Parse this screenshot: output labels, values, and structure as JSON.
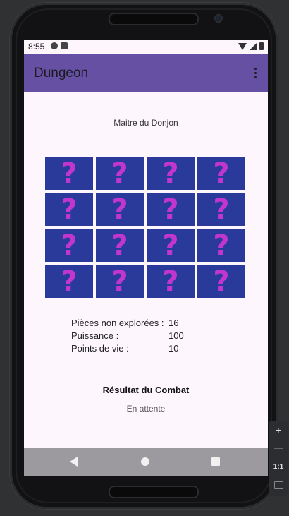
{
  "status_bar": {
    "time": "8:55"
  },
  "app_bar": {
    "title": "Dungeon"
  },
  "game": {
    "master_label": "Maitre du Donjon",
    "cell_symbol": "?",
    "cells_rows": 4,
    "cells_cols": 4
  },
  "stats": [
    {
      "label": "Pièces non explorées :",
      "value": "16"
    },
    {
      "label": "Puissance :",
      "value": "100"
    },
    {
      "label": "Points de vie :",
      "value": "10"
    }
  ],
  "result": {
    "title": "Résultat du Combat",
    "status": "En attente"
  },
  "emulator_toolbar": {
    "zoom_in": "+",
    "ratio": "1:1"
  },
  "colors": {
    "app_bar": "#6550a4",
    "cell_bg": "#2a3a9b",
    "cell_fg": "#c236cf",
    "screen_bg": "#fdf6fd",
    "nav_bar": "#9c9a9e"
  }
}
